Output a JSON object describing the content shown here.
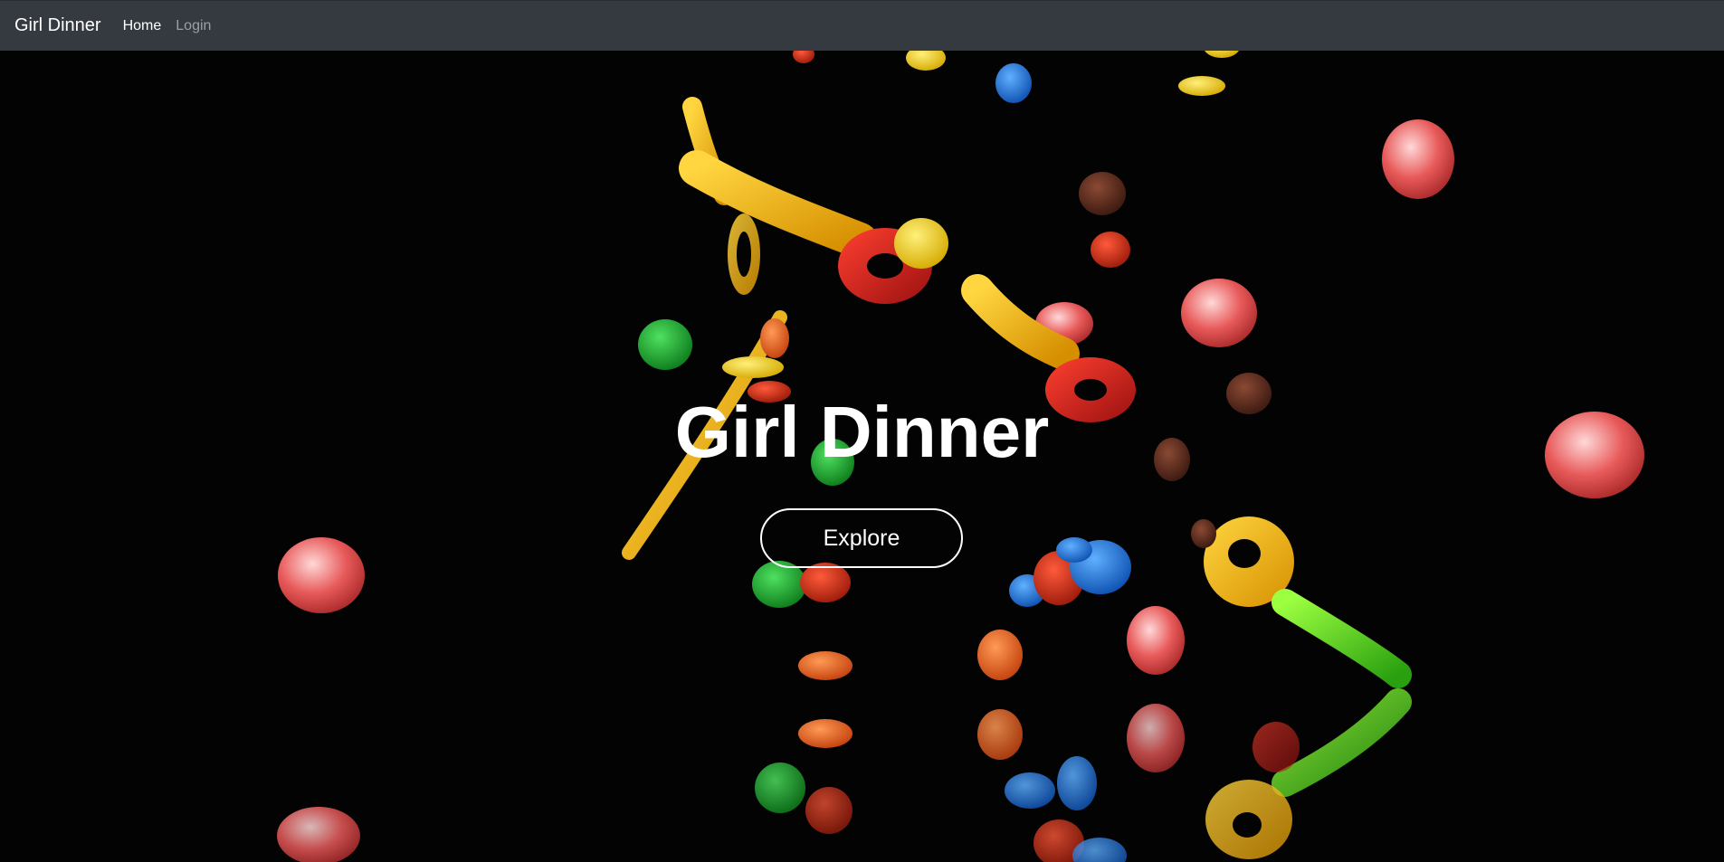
{
  "navbar": {
    "brand": "Girl Dinner",
    "links": [
      {
        "label": "Home",
        "active": true
      },
      {
        "label": "Login",
        "active": false
      }
    ],
    "background_color": "#343a40"
  },
  "hero": {
    "title": "Girl Dinner",
    "button_label": "Explore",
    "background_description_colors": [
      "#000000",
      "#ff5a1f",
      "#1e7be0",
      "#22aa33",
      "#ffd21a",
      "#e05060",
      "#5a2a1a"
    ]
  }
}
